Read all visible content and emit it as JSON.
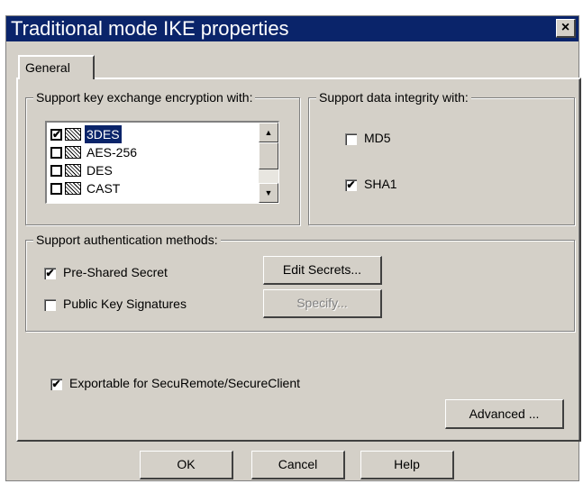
{
  "window": {
    "title": "Traditional mode IKE properties",
    "close_label": "×"
  },
  "tabs": [
    {
      "label": "General"
    }
  ],
  "encryption": {
    "group_label": "Support key exchange encryption with:",
    "items": [
      {
        "label": "3DES",
        "checked": true,
        "selected": true
      },
      {
        "label": "AES-256",
        "checked": false,
        "selected": false
      },
      {
        "label": "DES",
        "checked": false,
        "selected": false
      },
      {
        "label": "CAST",
        "checked": false,
        "selected": false
      }
    ],
    "scroll_up": "▲",
    "scroll_down": "▼"
  },
  "integrity": {
    "group_label": "Support data integrity with:",
    "md5": {
      "label": "MD5",
      "checked": false
    },
    "sha1": {
      "label": "SHA1",
      "checked": true
    }
  },
  "authentication": {
    "group_label": "Support authentication methods:",
    "pre_shared": {
      "label": "Pre-Shared Secret",
      "checked": true
    },
    "public_key": {
      "label": "Public Key Signatures",
      "checked": false
    },
    "edit_secrets_label": "Edit Secrets...",
    "specify_label": "Specify..."
  },
  "exportable": {
    "label": "Exportable for SecuRemote/SecureClient",
    "checked": true
  },
  "advanced_label": "Advanced ...",
  "footer": {
    "ok_label": "OK",
    "cancel_label": "Cancel",
    "help_label": "Help"
  },
  "check_mark": "✔"
}
